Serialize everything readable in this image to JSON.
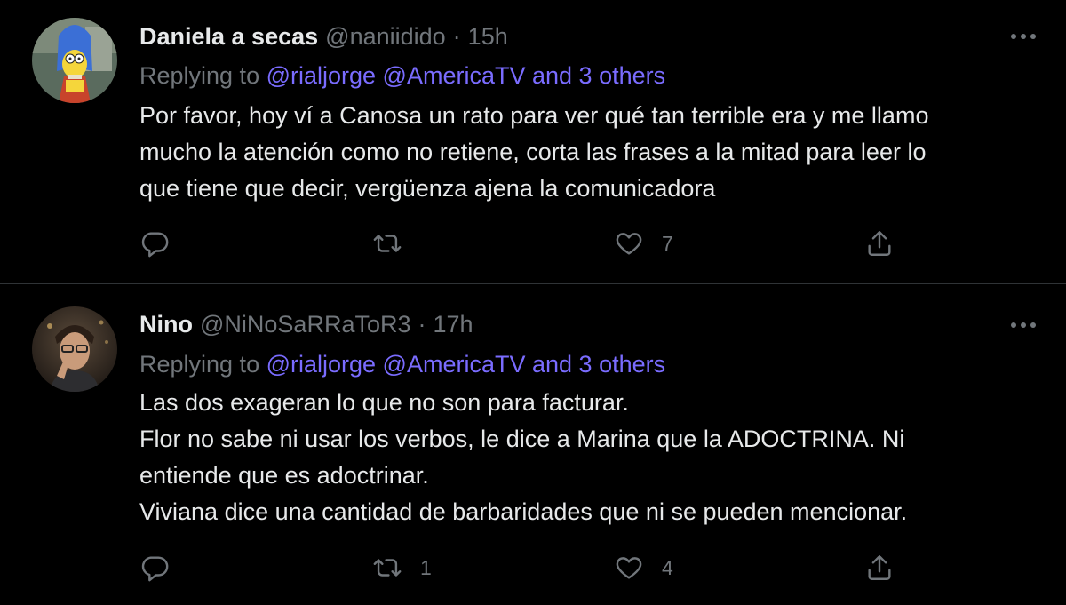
{
  "colors": {
    "background": "#000000",
    "divider": "#2f3336",
    "text": "#e7e9ea",
    "muted": "#71767b",
    "mention": "#7a6cff"
  },
  "tweets": [
    {
      "display_name": "Daniela a secas",
      "handle": "@naniidido",
      "separator": "·",
      "time": "15h",
      "replying_prefix": "Replying to",
      "replying_mentions": "@rialjorge @AmericaTV and 3 others",
      "body_lines": [
        "Por favor, hoy ví a Canosa un rato para ver qué tan terrible era y me llamo",
        "mucho la atención como no retiene, corta las frases a la mitad para leer lo",
        "que tiene que decir, vergüenza ajena la comunicadora"
      ],
      "replies": "",
      "retweets": "",
      "likes": "7",
      "avatar_icon": "cartoon-avatar-icon"
    },
    {
      "display_name": "Nino",
      "handle": "@NiNoSaRRaToR3",
      "separator": "·",
      "time": "17h",
      "replying_prefix": "Replying to",
      "replying_mentions": "@rialjorge @AmericaTV and 3 others",
      "body_lines": [
        "Las dos exageran lo que no son para facturar.",
        "Flor no sabe ni usar los verbos, le dice a Marina que la ADOCTRINA. Ni",
        "entiende que es adoctrinar.",
        "Viviana dice una cantidad de barbaridades que ni se pueden mencionar."
      ],
      "replies": "",
      "retweets": "1",
      "likes": "4",
      "avatar_icon": "photo-avatar-icon"
    }
  ],
  "icons": {
    "more": "more-horizontal-icon",
    "reply": "reply-icon",
    "retweet": "retweet-icon",
    "like": "heart-icon",
    "share": "share-icon"
  }
}
